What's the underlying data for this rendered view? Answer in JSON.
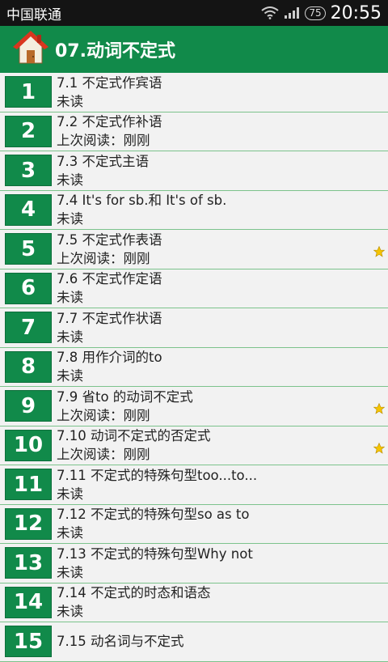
{
  "status": {
    "carrier": "中国联通",
    "battery": "75",
    "time": "20:55"
  },
  "header": {
    "title": "07.动词不定式"
  },
  "items": [
    {
      "num": "1",
      "title": "7.1 不定式作宾语",
      "status": "未读",
      "star": false
    },
    {
      "num": "2",
      "title": "7.2 不定式作补语",
      "status": "上次阅读：刚刚",
      "star": false
    },
    {
      "num": "3",
      "title": "7.3 不定式主语",
      "status": "未读",
      "star": false
    },
    {
      "num": "4",
      "title": "7.4 It's for sb.和 It's of sb.",
      "status": "未读",
      "star": false
    },
    {
      "num": "5",
      "title": "7.5 不定式作表语",
      "status": "上次阅读：刚刚",
      "star": true
    },
    {
      "num": "6",
      "title": "7.6 不定式作定语",
      "status": "未读",
      "star": false
    },
    {
      "num": "7",
      "title": "7.7 不定式作状语",
      "status": "未读",
      "star": false
    },
    {
      "num": "8",
      "title": "7.8 用作介词的to",
      "status": "未读",
      "star": false
    },
    {
      "num": "9",
      "title": "7.9 省to 的动词不定式",
      "status": "上次阅读：刚刚",
      "star": true
    },
    {
      "num": "10",
      "title": "7.10 动词不定式的否定式",
      "status": "上次阅读：刚刚",
      "star": true
    },
    {
      "num": "11",
      "title": "7.11 不定式的特殊句型too...to...",
      "status": "未读",
      "star": false
    },
    {
      "num": "12",
      "title": "7.12 不定式的特殊句型so as to",
      "status": "未读",
      "star": false
    },
    {
      "num": "13",
      "title": "7.13 不定式的特殊句型Why not",
      "status": "未读",
      "star": false
    },
    {
      "num": "14",
      "title": "7.14 不定式的时态和语态",
      "status": "未读",
      "star": false
    },
    {
      "num": "15",
      "title": "7.15 动名词与不定式",
      "status": "",
      "star": false
    }
  ],
  "colors": {
    "accent": "#118a4a",
    "statusbar": "#141414",
    "divider": "#7cc38c"
  }
}
